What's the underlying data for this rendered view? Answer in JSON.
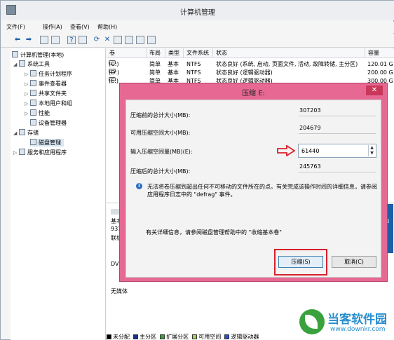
{
  "window": {
    "title": "计算机管理"
  },
  "menu": [
    "文件(F)",
    "操作(A)",
    "查看(V)",
    "帮助(H)"
  ],
  "tree": {
    "root": "计算机管理(本地)",
    "system_tools": "系统工具",
    "task_scheduler": "任务计划程序",
    "event_viewer": "事件查看器",
    "shared_folders": "共享文件夹",
    "local_users": "本地用户和组",
    "performance": "性能",
    "device_manager": "设备管理器",
    "storage": "存储",
    "disk_management": "磁盘管理",
    "services": "服务和应用程序"
  },
  "columns": [
    "卷",
    "布局",
    "类型",
    "文件系统",
    "状态",
    "容量"
  ],
  "volumes": [
    {
      "vol": "(C:)",
      "layout": "简单",
      "type": "基本",
      "fs": "NTFS",
      "status": "状态良好 (系统, 启动, 页面文件, 活动, 故障转储, 主分区)",
      "capacity": "120.01 G"
    },
    {
      "vol": "(D:)",
      "layout": "简单",
      "type": "基本",
      "fs": "NTFS",
      "status": "状态良好 (逻辑驱动器)",
      "capacity": "200.00 G"
    },
    {
      "vol": "(E:)",
      "layout": "简单",
      "type": "基本",
      "fs": "NTFS",
      "status": "状态良好 (逻辑驱动器)",
      "capacity": "300.00 G"
    }
  ],
  "lower": {
    "disk_label": "基本",
    "disk_size": "931",
    "disk_status": "联机",
    "dvd_label": "DV",
    "no_media": "无媒体",
    "right_lines": [
      "F",
      "1N",
      "5"
    ]
  },
  "legend": [
    "未分配",
    "主分区",
    "扩展分区",
    "可用空间",
    "逻辑驱动器"
  ],
  "legend_colors": [
    "#000000",
    "#1c2e8c",
    "#3aa03a",
    "#9bd15c",
    "#2b4ed1"
  ],
  "dialog": {
    "title": "压缩 E:",
    "close_label": "✕",
    "total_before_label": "压缩前的总计大小(MB):",
    "total_before_value": "307203",
    "available_label": "可用压缩空间大小(MB):",
    "available_value": "204679",
    "amount_label": "输入压缩空间量(MB)(E):",
    "amount_value": "61440",
    "total_after_label": "压缩后的总计大小(MB):",
    "total_after_value": "245763",
    "info": "无法将卷压缩到超出任何不可移动的文件所在的点。有关完成该操作时间的详细信息，请参阅应用程序日志中的 \"defrag\" 事件。",
    "help": "有关详细信息，请参阅磁盘管理帮助中的 \"收缩基本卷\"",
    "shrink_button": "压缩(S)",
    "cancel_button": "取消(C)"
  },
  "watermark": {
    "brand": "当客软件园",
    "url": "www.downkr.com"
  }
}
